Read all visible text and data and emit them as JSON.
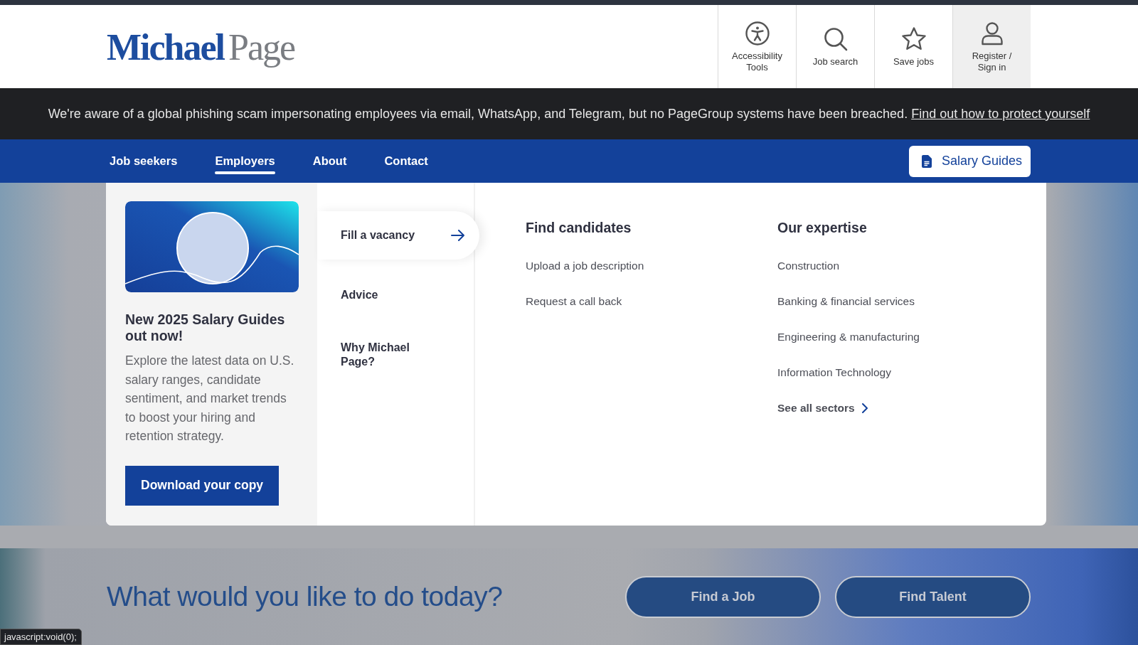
{
  "logo": {
    "part_1": "Michael",
    "part_2": "Page"
  },
  "header_actions": [
    {
      "label": "Accessibility Tools",
      "kind": "accessibility",
      "selected": false
    },
    {
      "label": "Job search",
      "kind": "search",
      "selected": false
    },
    {
      "label": "Save jobs",
      "kind": "star",
      "selected": false
    },
    {
      "label": "Register / Sign in",
      "kind": "user",
      "selected": true
    }
  ],
  "alert": {
    "text": "We're aware of a global phishing scam impersonating employees via email, WhatsApp, and Telegram, but no PageGroup systems have been breached.",
    "link": "Find out how to protect yourself"
  },
  "nav": {
    "items": [
      {
        "label": "Job seekers",
        "selected": false
      },
      {
        "label": "Employers",
        "selected": true
      },
      {
        "label": "About",
        "selected": false
      },
      {
        "label": "Contact",
        "selected": false
      }
    ],
    "salary_button": "Salary Guides"
  },
  "mega_menu": {
    "promo": {
      "title": "New 2025 Salary Guides out now!",
      "text": "Explore the latest data on U.S. salary ranges, candidate sentiment, and market trends to boost your hiring and retention strategy.",
      "button": "Download your copy"
    },
    "sections": [
      {
        "label": "Fill a vacancy",
        "selected": true
      },
      {
        "label": "Advice",
        "selected": false
      },
      {
        "label": "Why Michael Page?",
        "selected": false
      }
    ],
    "columns": [
      {
        "heading": "Find candidates",
        "links": [
          "Upload a job description",
          "Request a call back"
        ]
      },
      {
        "heading": "Our expertise",
        "links": [
          "Construction",
          "Banking & financial services",
          "Engineering & manufacturing",
          "Information Technology"
        ],
        "more": "See all sectors"
      }
    ]
  },
  "hero": {
    "heading": "What would you like to do today?",
    "buttons": [
      "Find a Job",
      "Find Talent"
    ]
  },
  "status_bar": {
    "url": "javascript:void(0);"
  }
}
